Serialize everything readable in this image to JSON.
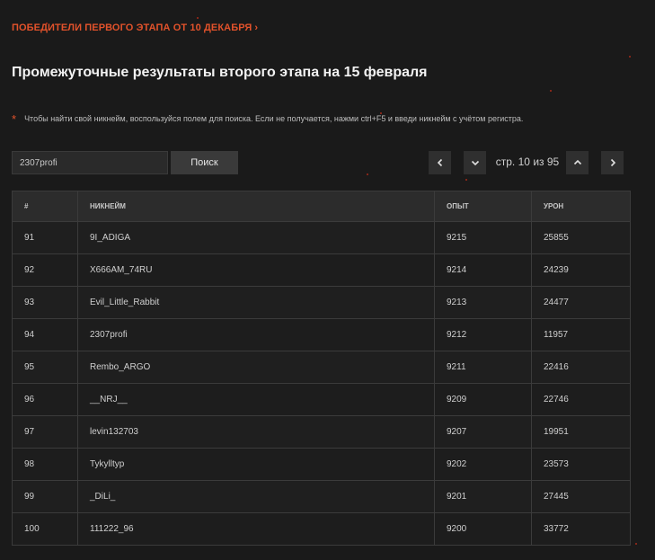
{
  "header": {
    "winners_link": "ПОБЕДИТЕЛИ ПЕРВОГО ЭТАПА ОТ 10 ДЕКАБРЯ",
    "title": "Промежуточные результаты второго этапа на 15 февраля",
    "hint": "Чтобы найти свой никнейм, воспользуйся полем для поиска. Если не получается, нажми ctrl+F5 и введи никнейм с учётом регистра."
  },
  "search": {
    "value": "2307profi",
    "button_label": "Поиск"
  },
  "pagination": {
    "prefix": "стр.",
    "current": "10",
    "separator": "из",
    "total": "95"
  },
  "colors": {
    "accent": "#e2522b",
    "background": "#1a1a1a"
  },
  "table": {
    "headers": [
      "#",
      "НИКНЕЙМ",
      "ОПЫТ",
      "УРОН"
    ],
    "rows": [
      [
        "91",
        "9I_ADIGA",
        "9215",
        "25855"
      ],
      [
        "92",
        "X666AM_74RU",
        "9214",
        "24239"
      ],
      [
        "93",
        "Evil_Little_Rabbit",
        "9213",
        "24477"
      ],
      [
        "94",
        "2307profi",
        "9212",
        "11957"
      ],
      [
        "95",
        "Rembo_ARGO",
        "9211",
        "22416"
      ],
      [
        "96",
        "__NRJ__",
        "9209",
        "22746"
      ],
      [
        "97",
        "levin132703",
        "9207",
        "19951"
      ],
      [
        "98",
        "Tykylltyp",
        "9202",
        "23573"
      ],
      [
        "99",
        "_DiLi_",
        "9201",
        "27445"
      ],
      [
        "100",
        "111222_96",
        "9200",
        "33772"
      ]
    ]
  }
}
